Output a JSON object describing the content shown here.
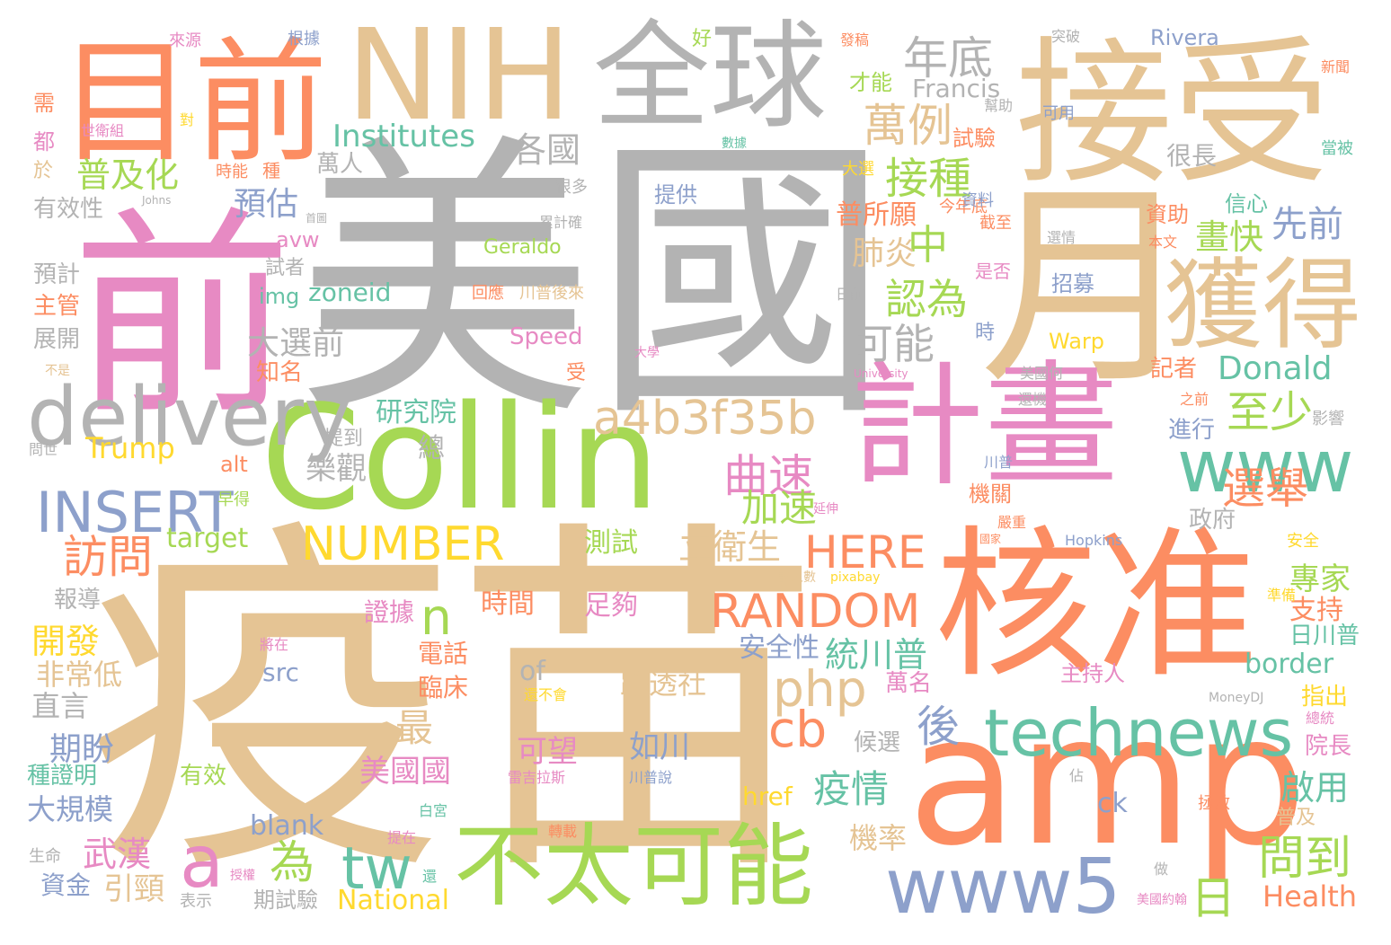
{
  "palette": {
    "gray": "#b3b3b3",
    "tan": "#e5c494",
    "orange": "#fc8d62",
    "pink": "#e78ac3",
    "green": "#a6d854",
    "teal": "#66c2a5",
    "blue": "#8da0cb",
    "yellow": "#ffd92f"
  },
  "words": [
    {
      "text": "美國",
      "color": "#b3b3b3"
    },
    {
      "text": "疫苗",
      "color": "#e5c494"
    },
    {
      "text": "接受",
      "color": "#e5c494"
    },
    {
      "text": "前",
      "color": "#e78ac3"
    },
    {
      "text": "Collin",
      "color": "#a6d854"
    },
    {
      "text": "核准",
      "color": "#fc8d62"
    },
    {
      "text": "amp",
      "color": "#fc8d62"
    },
    {
      "text": "月",
      "color": "#e5c494"
    },
    {
      "text": "計畫",
      "color": "#e78ac3"
    },
    {
      "text": "目前",
      "color": "#fc8d62"
    },
    {
      "text": "NIH",
      "color": "#e5c494"
    },
    {
      "text": "全球",
      "color": "#b3b3b3"
    },
    {
      "text": "獲得",
      "color": "#e5c494"
    },
    {
      "text": "不太可能",
      "color": "#a6d854"
    },
    {
      "text": "delivery",
      "color": "#b3b3b3"
    },
    {
      "text": "technews",
      "color": "#66c2a5"
    },
    {
      "text": "www5",
      "color": "#8da0cb"
    },
    {
      "text": "www",
      "color": "#66c2a5"
    },
    {
      "text": "a4b3f35b",
      "color": "#e5c494"
    },
    {
      "text": "INSERT",
      "color": "#8da0cb"
    },
    {
      "text": "RANDOM",
      "color": "#fc8d62"
    },
    {
      "text": "NUMBER",
      "color": "#ffd92f"
    },
    {
      "text": "HERE",
      "color": "#fc8d62"
    },
    {
      "text": "php",
      "color": "#e5c494"
    },
    {
      "text": "a",
      "color": "#e78ac3"
    },
    {
      "text": "tw",
      "color": "#66c2a5"
    },
    {
      "text": "年底",
      "color": "#b3b3b3"
    },
    {
      "text": "萬例",
      "color": "#e5c494"
    },
    {
      "text": "接種",
      "color": "#a6d854"
    },
    {
      "text": "各國",
      "color": "#b3b3b3"
    },
    {
      "text": "普及化",
      "color": "#a6d854"
    },
    {
      "text": "Institutes",
      "color": "#66c2a5"
    },
    {
      "text": "預估",
      "color": "#8da0cb"
    },
    {
      "text": "普所願",
      "color": "#fc8d62"
    },
    {
      "text": "中",
      "color": "#a6d854"
    },
    {
      "text": "肺炎",
      "color": "#e5c494"
    },
    {
      "text": "認為",
      "color": "#a6d854"
    },
    {
      "text": "可能",
      "color": "#b3b3b3"
    },
    {
      "text": "大選前",
      "color": "#b3b3b3"
    },
    {
      "text": "至少",
      "color": "#a6d854"
    },
    {
      "text": "畫快",
      "color": "#a6d854"
    },
    {
      "text": "先前",
      "color": "#8da0cb"
    },
    {
      "text": "Donald",
      "color": "#66c2a5"
    },
    {
      "text": "曲速",
      "color": "#e78ac3"
    },
    {
      "text": "Trump",
      "color": "#ffd92f"
    },
    {
      "text": "選舉",
      "color": "#fc8d62"
    },
    {
      "text": "加速",
      "color": "#a6d854"
    },
    {
      "text": "立衛生",
      "color": "#e5c494"
    },
    {
      "text": "訪問",
      "color": "#fc8d62"
    },
    {
      "text": "target",
      "color": "#a6d854"
    },
    {
      "text": "cb",
      "color": "#fc8d62"
    },
    {
      "text": "後",
      "color": "#8da0cb"
    },
    {
      "text": "問到",
      "color": "#a6d854"
    },
    {
      "text": "日",
      "color": "#a6d854"
    },
    {
      "text": "n",
      "color": "#a6d854"
    },
    {
      "text": "統川普",
      "color": "#66c2a5"
    },
    {
      "text": "疫情",
      "color": "#66c2a5"
    },
    {
      "text": "武漢",
      "color": "#e78ac3"
    },
    {
      "text": "為",
      "color": "#a6d854"
    },
    {
      "text": "Health",
      "color": "#fc8d62"
    },
    {
      "text": "National",
      "color": "#ffd92f"
    },
    {
      "text": "border",
      "color": "#66c2a5"
    },
    {
      "text": "美國國",
      "color": "#e78ac3"
    },
    {
      "text": "最",
      "color": "#e5c494"
    },
    {
      "text": "研究院",
      "color": "#66c2a5"
    },
    {
      "text": "樂觀",
      "color": "#b3b3b3"
    },
    {
      "text": "總",
      "color": "#b3b3b3"
    },
    {
      "text": "期盼",
      "color": "#8da0cb"
    },
    {
      "text": "開發",
      "color": "#ffd92f"
    },
    {
      "text": "非常低",
      "color": "#e5c494"
    },
    {
      "text": "直言",
      "color": "#b3b3b3"
    },
    {
      "text": "大規模",
      "color": "#8da0cb"
    },
    {
      "text": "引頸",
      "color": "#e5c494"
    },
    {
      "text": "資金",
      "color": "#8da0cb"
    },
    {
      "text": "of",
      "color": "#b3b3b3"
    },
    {
      "text": "路透社",
      "color": "#e5c494"
    },
    {
      "text": "可望",
      "color": "#e78ac3"
    },
    {
      "text": "如川",
      "color": "#8da0cb"
    },
    {
      "text": "src",
      "color": "#8da0cb"
    },
    {
      "text": "href",
      "color": "#ffd92f"
    },
    {
      "text": "blank",
      "color": "#8da0cb"
    },
    {
      "text": "ck",
      "color": "#8da0cb"
    },
    {
      "text": "啟用",
      "color": "#66c2a5"
    },
    {
      "text": "專家",
      "color": "#a6d854"
    },
    {
      "text": "支持",
      "color": "#fc8d62"
    },
    {
      "text": "日川普",
      "color": "#66c2a5"
    },
    {
      "text": "院長",
      "color": "#e78ac3"
    },
    {
      "text": "指出",
      "color": "#ffd92f"
    },
    {
      "text": "機率",
      "color": "#e5c494"
    },
    {
      "text": "萬名",
      "color": "#e78ac3"
    },
    {
      "text": "主持人",
      "color": "#e78ac3"
    },
    {
      "text": "候選",
      "color": "#b3b3b3"
    },
    {
      "text": "安全性",
      "color": "#8da0cb"
    },
    {
      "text": "時間",
      "color": "#fc8d62"
    },
    {
      "text": "足夠",
      "color": "#e78ac3"
    },
    {
      "text": "證據",
      "color": "#e78ac3"
    },
    {
      "text": "電話",
      "color": "#fc8d62"
    },
    {
      "text": "臨床",
      "color": "#fc8d62"
    },
    {
      "text": "測試",
      "color": "#a6d854"
    },
    {
      "text": "政府",
      "color": "#b3b3b3"
    },
    {
      "text": "機關",
      "color": "#fc8d62"
    },
    {
      "text": "進行",
      "color": "#8da0cb"
    },
    {
      "text": "記者",
      "color": "#fc8d62"
    },
    {
      "text": "資助",
      "color": "#fc8d62"
    },
    {
      "text": "很長",
      "color": "#b3b3b3"
    },
    {
      "text": "信心",
      "color": "#66c2a5"
    },
    {
      "text": "試驗",
      "color": "#fc8d62"
    },
    {
      "text": "才能",
      "color": "#a6d854"
    },
    {
      "text": "Francis",
      "color": "#b3b3b3"
    },
    {
      "text": "Rivera",
      "color": "#8da0cb"
    },
    {
      "text": "好",
      "color": "#a6d854"
    },
    {
      "text": "萬人",
      "color": "#b3b3b3"
    },
    {
      "text": "提供",
      "color": "#8da0cb"
    },
    {
      "text": "有效性",
      "color": "#b3b3b3"
    },
    {
      "text": "預計",
      "color": "#b3b3b3"
    },
    {
      "text": "主管",
      "color": "#fc8d62"
    },
    {
      "text": "展開",
      "color": "#b3b3b3"
    },
    {
      "text": "知名",
      "color": "#fc8d62"
    },
    {
      "text": "試者",
      "color": "#b3b3b3"
    },
    {
      "text": "avw",
      "color": "#e78ac3"
    },
    {
      "text": "img",
      "color": "#66c2a5"
    },
    {
      "text": "zoneid",
      "color": "#66c2a5"
    },
    {
      "text": "alt",
      "color": "#fc8d62"
    },
    {
      "text": "Speed",
      "color": "#e78ac3"
    },
    {
      "text": "Warp",
      "color": "#ffd92f"
    },
    {
      "text": "Geraldo",
      "color": "#a6d854"
    },
    {
      "text": "招募",
      "color": "#8da0cb"
    },
    {
      "text": "報導",
      "color": "#b3b3b3"
    },
    {
      "text": "需",
      "color": "#fc8d62"
    },
    {
      "text": "都",
      "color": "#e78ac3"
    },
    {
      "text": "於",
      "color": "#e5c494"
    },
    {
      "text": "種證明",
      "color": "#66c2a5"
    },
    {
      "text": "有效",
      "color": "#a6d854"
    },
    {
      "text": "生命",
      "color": "#b3b3b3"
    },
    {
      "text": "表示",
      "color": "#b3b3b3"
    },
    {
      "text": "期試驗",
      "color": "#b3b3b3"
    },
    {
      "text": "提到",
      "color": "#b3b3b3"
    },
    {
      "text": "受",
      "color": "#fc8d62"
    },
    {
      "text": "時",
      "color": "#8da0cb"
    },
    {
      "text": "是否",
      "color": "#e78ac3"
    },
    {
      "text": "今年底",
      "color": "#fc8d62"
    },
    {
      "text": "截至",
      "color": "#fc8d62"
    },
    {
      "text": "資料",
      "color": "#8da0cb"
    },
    {
      "text": "大選",
      "color": "#ffd92f"
    },
    {
      "text": "時能",
      "color": "#fc8d62"
    },
    {
      "text": "種",
      "color": "#fc8d62"
    },
    {
      "text": "很多",
      "color": "#b3b3b3"
    },
    {
      "text": "累計確",
      "color": "#b3b3b3"
    },
    {
      "text": "回應",
      "color": "#fc8d62"
    },
    {
      "text": "川普後來",
      "color": "#e5c494"
    },
    {
      "text": "日前",
      "color": "#b3b3b3"
    },
    {
      "text": "美國何",
      "color": "#b3b3b3"
    },
    {
      "text": "選情",
      "color": "#b3b3b3"
    },
    {
      "text": "本文",
      "color": "#fc8d62"
    },
    {
      "text": "影響",
      "color": "#b3b3b3"
    },
    {
      "text": "之前",
      "color": "#fc8d62"
    },
    {
      "text": "還機",
      "color": "#b3b3b3"
    },
    {
      "text": "川普",
      "color": "#8da0cb"
    },
    {
      "text": "Hopkins",
      "color": "#8da0cb"
    },
    {
      "text": "準備",
      "color": "#ffd92f"
    },
    {
      "text": "MoneyDJ",
      "color": "#b3b3b3"
    },
    {
      "text": "總統",
      "color": "#e78ac3"
    },
    {
      "text": "安全",
      "color": "#ffd92f"
    },
    {
      "text": "嚴重",
      "color": "#fc8d62"
    },
    {
      "text": "國家",
      "color": "#fc8d62"
    },
    {
      "text": "拯救",
      "color": "#fc8d62"
    },
    {
      "text": "普及",
      "color": "#e5c494"
    },
    {
      "text": "佔",
      "color": "#b3b3b3"
    },
    {
      "text": "做",
      "color": "#b3b3b3"
    },
    {
      "text": "美國約翰",
      "color": "#e78ac3"
    },
    {
      "text": "轉載",
      "color": "#fc8d62"
    },
    {
      "text": "提在",
      "color": "#e78ac3"
    },
    {
      "text": "還",
      "color": "#66c2a5"
    },
    {
      "text": "授權",
      "color": "#e78ac3"
    },
    {
      "text": "將在",
      "color": "#e78ac3"
    },
    {
      "text": "還不會",
      "color": "#ffd92f"
    },
    {
      "text": "雷吉拉斯",
      "color": "#e78ac3"
    },
    {
      "text": "川普說",
      "color": "#8da0cb"
    },
    {
      "text": "白宮",
      "color": "#66c2a5"
    },
    {
      "text": "診人數",
      "color": "#e5c494"
    },
    {
      "text": "pixabay",
      "color": "#ffd92f"
    },
    {
      "text": "延伸",
      "color": "#e78ac3"
    },
    {
      "text": "早得",
      "color": "#a6d854"
    },
    {
      "text": "問世",
      "color": "#b3b3b3"
    },
    {
      "text": "不是",
      "color": "#e5c494"
    },
    {
      "text": "University",
      "color": "#e78ac3"
    },
    {
      "text": "大學",
      "color": "#e78ac3"
    },
    {
      "text": "首圖",
      "color": "#b3b3b3"
    },
    {
      "text": "Johns",
      "color": "#b3b3b3"
    },
    {
      "text": "世衛組",
      "color": "#e78ac3"
    },
    {
      "text": "對",
      "color": "#ffd92f"
    },
    {
      "text": "可用",
      "color": "#8da0cb"
    },
    {
      "text": "數據",
      "color": "#66c2a5"
    },
    {
      "text": "來源",
      "color": "#e78ac3"
    },
    {
      "text": "根據",
      "color": "#8da0cb"
    },
    {
      "text": "發稿",
      "color": "#fc8d62"
    },
    {
      "text": "突破",
      "color": "#b3b3b3"
    },
    {
      "text": "新聞",
      "color": "#fc8d62"
    },
    {
      "text": "幫助",
      "color": "#b3b3b3"
    },
    {
      "text": "當被",
      "color": "#66c2a5"
    }
  ]
}
